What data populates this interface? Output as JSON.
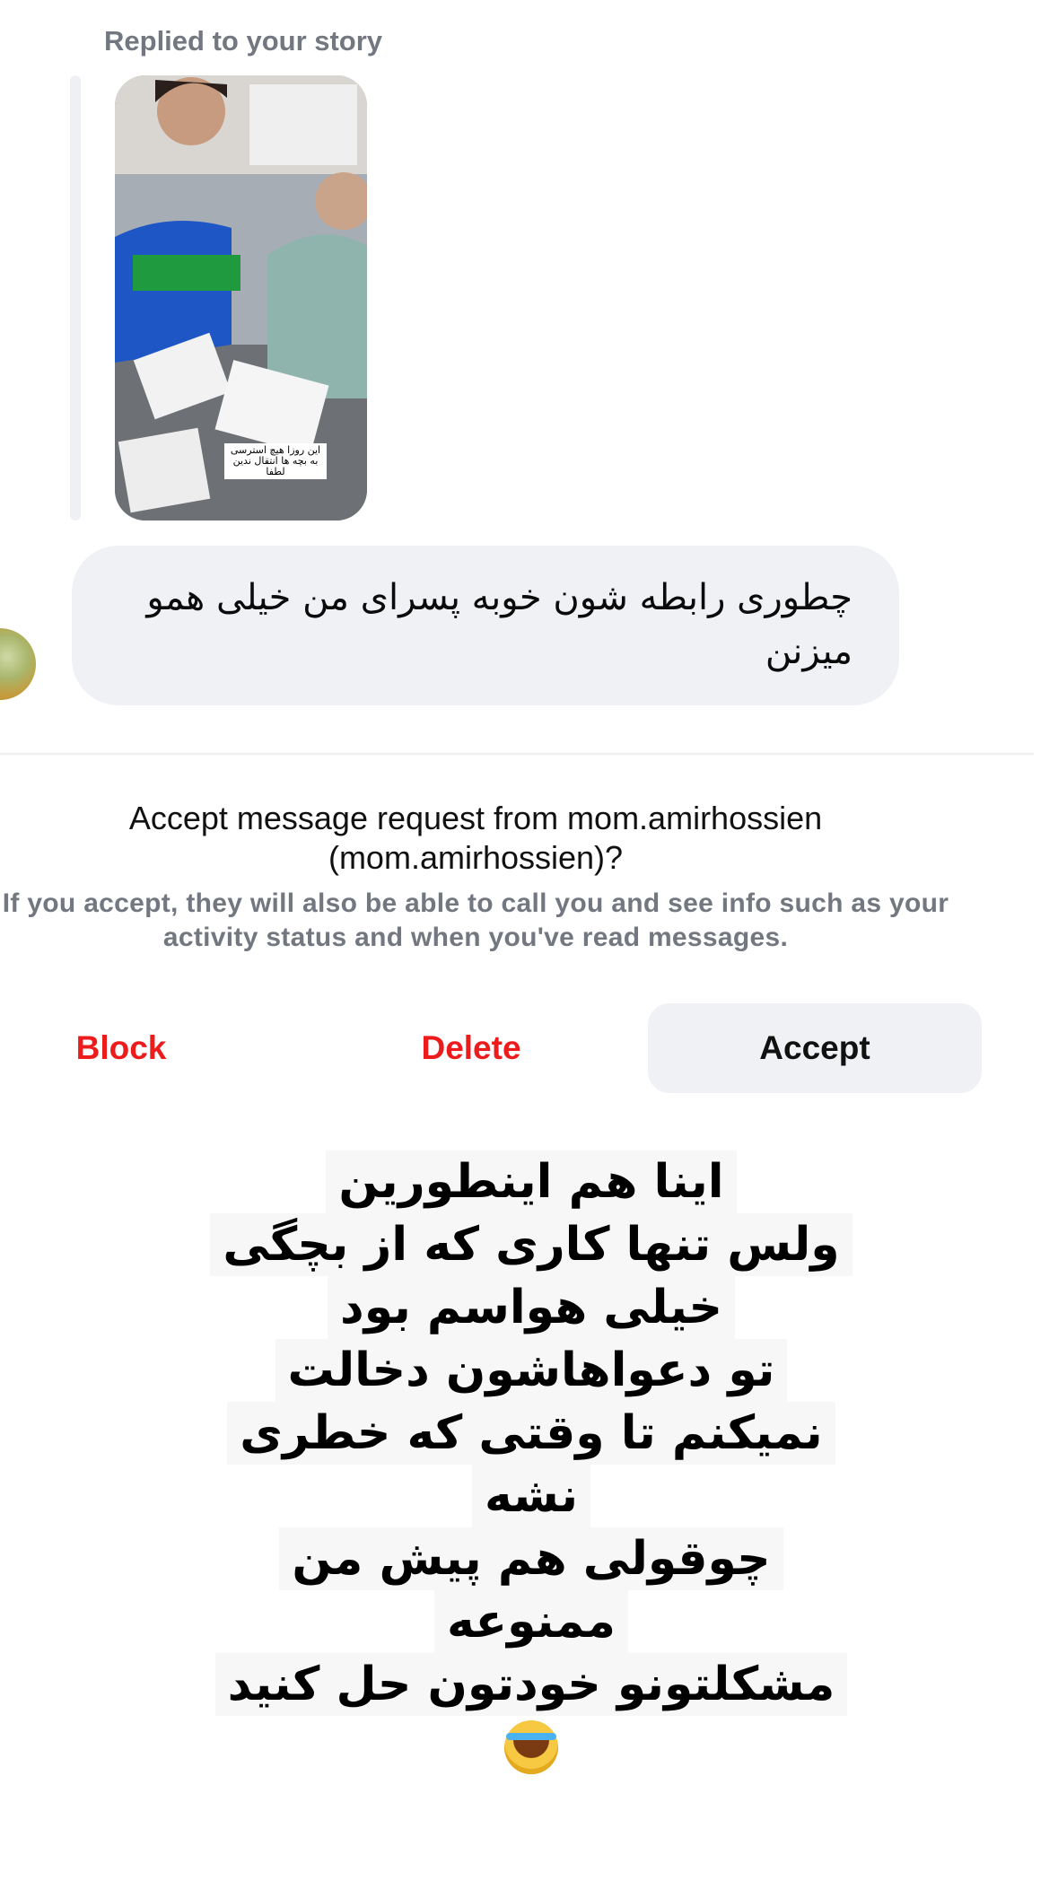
{
  "story_reply": {
    "label": "Replied to your story",
    "story_caption": "این روزا هیچ استرسی به بچه ها انتقال ندین لطفا"
  },
  "message": {
    "text": "چطوری رابطه شون خوبه پسرای من خیلی همو میزنن"
  },
  "request": {
    "title_prefix": "Accept message request from mom.amirhossien",
    "title_username": "(mom.amirhossien)?",
    "subtitle": "If you accept, they will also be able to call you and see info such as your activity status and when you've read messages."
  },
  "actions": {
    "block": "Block",
    "delete": "Delete",
    "accept": "Accept"
  },
  "overlay_text": {
    "lines": [
      "اینا هم اینطورین",
      "ولس تنها کاری که از بچگی",
      "خیلی هواسم بود",
      "تو دعواهاشون دخالت",
      "نمیکنم تا وقتی که خطری",
      "نشه",
      "چوقولی هم پیش من",
      "ممنوعه",
      "مشکلتونو خودتون حل کنید"
    ],
    "emoji": "laughing-with-tears-emoji"
  },
  "colors": {
    "destructive": "#ed1c1c",
    "bubble": "#eff1f4",
    "secondary_text": "#737880"
  }
}
